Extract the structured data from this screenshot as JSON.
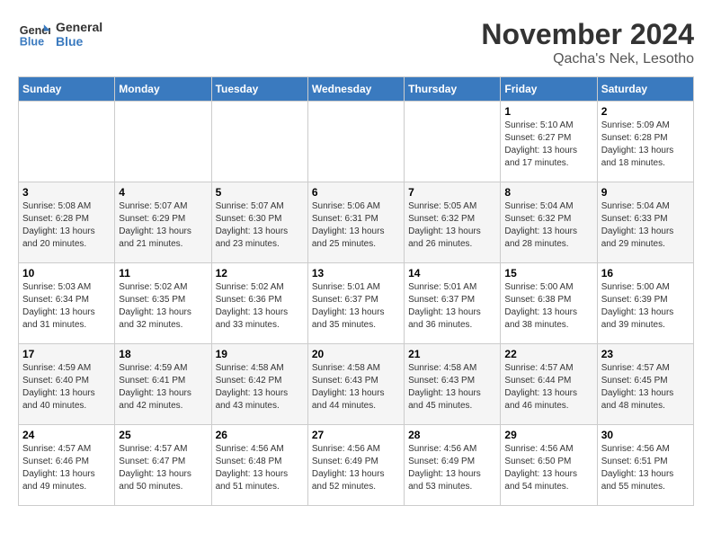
{
  "logo": {
    "line1": "General",
    "line2": "Blue"
  },
  "title": "November 2024",
  "subtitle": "Qacha's Nek, Lesotho",
  "days_of_week": [
    "Sunday",
    "Monday",
    "Tuesday",
    "Wednesday",
    "Thursday",
    "Friday",
    "Saturday"
  ],
  "weeks": [
    [
      {
        "day": "",
        "info": ""
      },
      {
        "day": "",
        "info": ""
      },
      {
        "day": "",
        "info": ""
      },
      {
        "day": "",
        "info": ""
      },
      {
        "day": "",
        "info": ""
      },
      {
        "day": "1",
        "info": "Sunrise: 5:10 AM\nSunset: 6:27 PM\nDaylight: 13 hours\nand 17 minutes."
      },
      {
        "day": "2",
        "info": "Sunrise: 5:09 AM\nSunset: 6:28 PM\nDaylight: 13 hours\nand 18 minutes."
      }
    ],
    [
      {
        "day": "3",
        "info": "Sunrise: 5:08 AM\nSunset: 6:28 PM\nDaylight: 13 hours\nand 20 minutes."
      },
      {
        "day": "4",
        "info": "Sunrise: 5:07 AM\nSunset: 6:29 PM\nDaylight: 13 hours\nand 21 minutes."
      },
      {
        "day": "5",
        "info": "Sunrise: 5:07 AM\nSunset: 6:30 PM\nDaylight: 13 hours\nand 23 minutes."
      },
      {
        "day": "6",
        "info": "Sunrise: 5:06 AM\nSunset: 6:31 PM\nDaylight: 13 hours\nand 25 minutes."
      },
      {
        "day": "7",
        "info": "Sunrise: 5:05 AM\nSunset: 6:32 PM\nDaylight: 13 hours\nand 26 minutes."
      },
      {
        "day": "8",
        "info": "Sunrise: 5:04 AM\nSunset: 6:32 PM\nDaylight: 13 hours\nand 28 minutes."
      },
      {
        "day": "9",
        "info": "Sunrise: 5:04 AM\nSunset: 6:33 PM\nDaylight: 13 hours\nand 29 minutes."
      }
    ],
    [
      {
        "day": "10",
        "info": "Sunrise: 5:03 AM\nSunset: 6:34 PM\nDaylight: 13 hours\nand 31 minutes."
      },
      {
        "day": "11",
        "info": "Sunrise: 5:02 AM\nSunset: 6:35 PM\nDaylight: 13 hours\nand 32 minutes."
      },
      {
        "day": "12",
        "info": "Sunrise: 5:02 AM\nSunset: 6:36 PM\nDaylight: 13 hours\nand 33 minutes."
      },
      {
        "day": "13",
        "info": "Sunrise: 5:01 AM\nSunset: 6:37 PM\nDaylight: 13 hours\nand 35 minutes."
      },
      {
        "day": "14",
        "info": "Sunrise: 5:01 AM\nSunset: 6:37 PM\nDaylight: 13 hours\nand 36 minutes."
      },
      {
        "day": "15",
        "info": "Sunrise: 5:00 AM\nSunset: 6:38 PM\nDaylight: 13 hours\nand 38 minutes."
      },
      {
        "day": "16",
        "info": "Sunrise: 5:00 AM\nSunset: 6:39 PM\nDaylight: 13 hours\nand 39 minutes."
      }
    ],
    [
      {
        "day": "17",
        "info": "Sunrise: 4:59 AM\nSunset: 6:40 PM\nDaylight: 13 hours\nand 40 minutes."
      },
      {
        "day": "18",
        "info": "Sunrise: 4:59 AM\nSunset: 6:41 PM\nDaylight: 13 hours\nand 42 minutes."
      },
      {
        "day": "19",
        "info": "Sunrise: 4:58 AM\nSunset: 6:42 PM\nDaylight: 13 hours\nand 43 minutes."
      },
      {
        "day": "20",
        "info": "Sunrise: 4:58 AM\nSunset: 6:43 PM\nDaylight: 13 hours\nand 44 minutes."
      },
      {
        "day": "21",
        "info": "Sunrise: 4:58 AM\nSunset: 6:43 PM\nDaylight: 13 hours\nand 45 minutes."
      },
      {
        "day": "22",
        "info": "Sunrise: 4:57 AM\nSunset: 6:44 PM\nDaylight: 13 hours\nand 46 minutes."
      },
      {
        "day": "23",
        "info": "Sunrise: 4:57 AM\nSunset: 6:45 PM\nDaylight: 13 hours\nand 48 minutes."
      }
    ],
    [
      {
        "day": "24",
        "info": "Sunrise: 4:57 AM\nSunset: 6:46 PM\nDaylight: 13 hours\nand 49 minutes."
      },
      {
        "day": "25",
        "info": "Sunrise: 4:57 AM\nSunset: 6:47 PM\nDaylight: 13 hours\nand 50 minutes."
      },
      {
        "day": "26",
        "info": "Sunrise: 4:56 AM\nSunset: 6:48 PM\nDaylight: 13 hours\nand 51 minutes."
      },
      {
        "day": "27",
        "info": "Sunrise: 4:56 AM\nSunset: 6:49 PM\nDaylight: 13 hours\nand 52 minutes."
      },
      {
        "day": "28",
        "info": "Sunrise: 4:56 AM\nSunset: 6:49 PM\nDaylight: 13 hours\nand 53 minutes."
      },
      {
        "day": "29",
        "info": "Sunrise: 4:56 AM\nSunset: 6:50 PM\nDaylight: 13 hours\nand 54 minutes."
      },
      {
        "day": "30",
        "info": "Sunrise: 4:56 AM\nSunset: 6:51 PM\nDaylight: 13 hours\nand 55 minutes."
      }
    ]
  ]
}
